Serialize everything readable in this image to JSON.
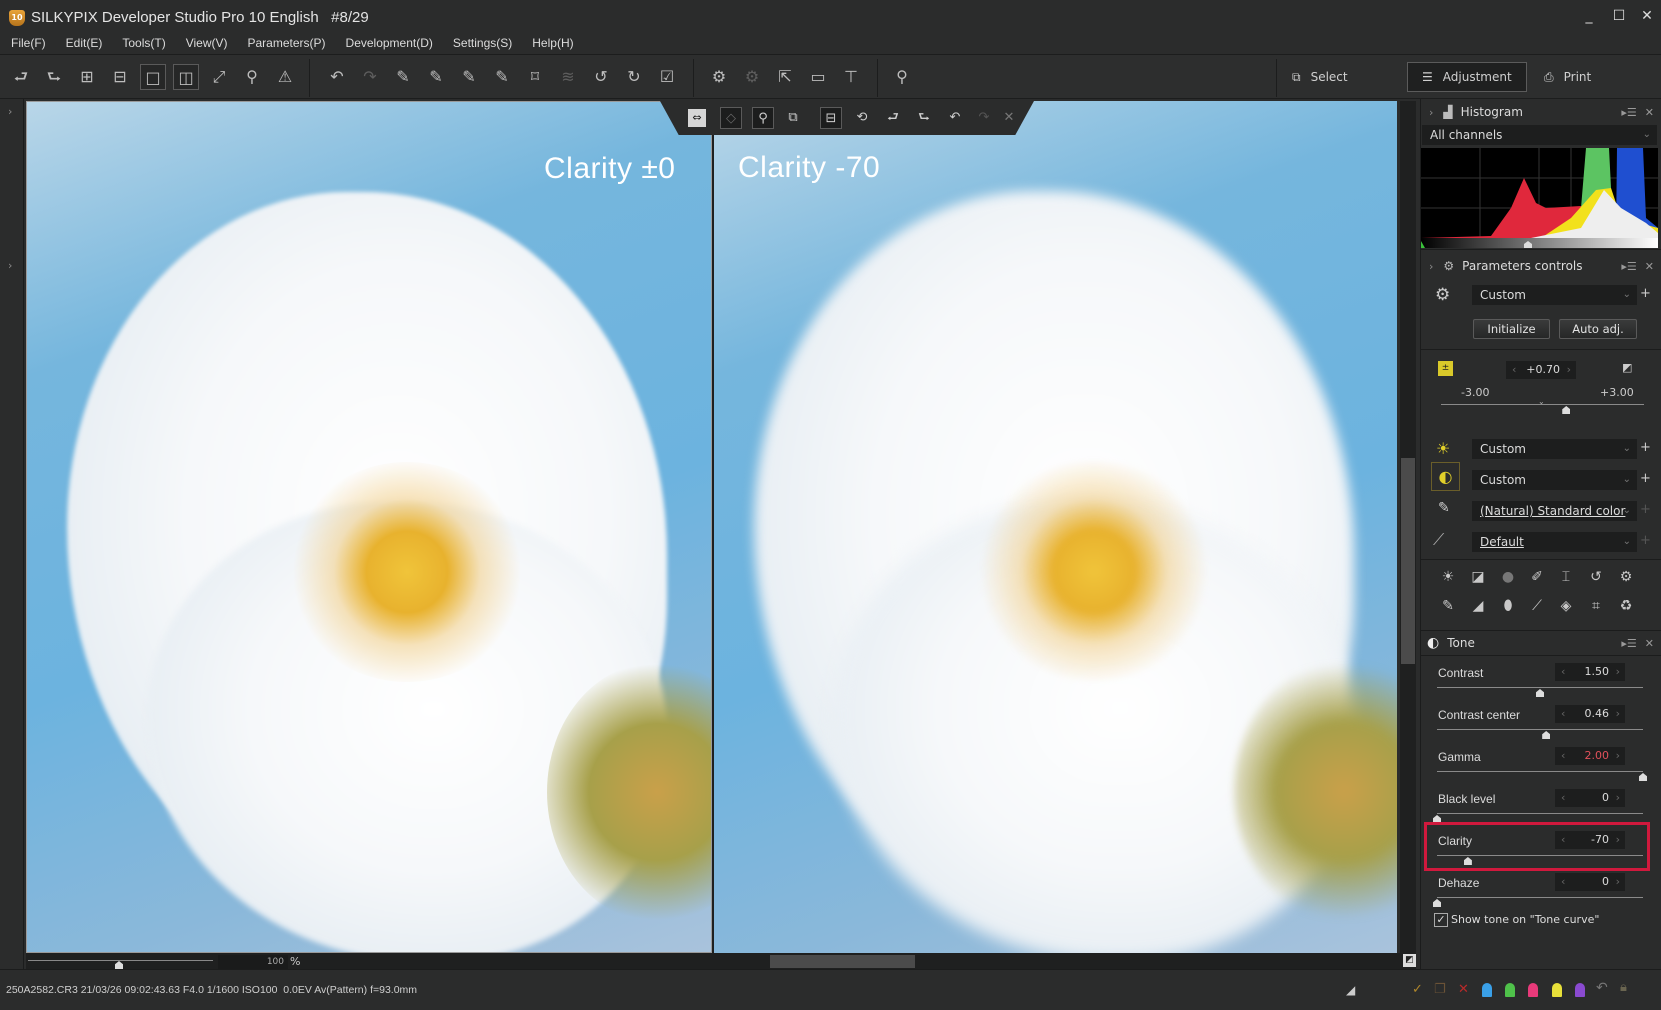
{
  "window": {
    "logo_text": "10",
    "title": "SILKYPIX Developer Studio Pro 10 English   #8/29",
    "controls": {
      "minimize": "_",
      "maximize": "☐",
      "close": "✕"
    }
  },
  "menu": [
    "File(F)",
    "Edit(E)",
    "Tools(T)",
    "View(V)",
    "Parameters(P)",
    "Development(D)",
    "Settings(S)",
    "Help(H)"
  ],
  "toolbar": {
    "icons": [
      "prev-photo-icon",
      "next-photo-icon",
      "thumbnail-grid-icon",
      "thumbnail-preview-icon",
      "single-view-icon",
      "compare-view-icon",
      "fullscreen-icon",
      "zoom-icon",
      "warning-icon",
      "undo-icon",
      "redo-icon",
      "paste-exposure-icon",
      "paste-tone-icon",
      "paste-contrast-icon",
      "paste-params-icon",
      "transform-icon",
      "layers-icon",
      "rotate-left-icon",
      "rotate-right-icon",
      "mark-icon",
      "save-params-icon",
      "apply-params-icon",
      "export-icon",
      "preview-screen-icon",
      "hammer-icon",
      "search-photo-icon"
    ],
    "modes": [
      {
        "label": "Select",
        "icon": "select-mode-icon",
        "active": false
      },
      {
        "label": "Adjustment",
        "icon": "adjustment-mode-icon",
        "active": true
      },
      {
        "label": "Print",
        "icon": "printer-icon",
        "active": false
      }
    ]
  },
  "viewer": {
    "left_label": "Clarity ±0",
    "right_label": "Clarity -70",
    "zoom_value": "100",
    "zoom_unit": "%",
    "compare_bar_icons": [
      "swap-left-icon",
      "swap-right-icon",
      "loupe-icon",
      "overlay-icon",
      "link-views-icon",
      "sync-icon",
      "prev-photo-icon",
      "next-photo-icon",
      "undo-icon",
      "redo-icon",
      "close-icon"
    ]
  },
  "status": {
    "text": "250A2582.CR3 21/03/26 09:02:43.63 F4.0 1/1600 ISO100  0.0EV Av(Pattern) f=93.0mm",
    "tag_colors": [
      "#3aa0e8",
      "#4fc14a",
      "#e83a7a",
      "#e8e03a",
      "#8a4ad0"
    ]
  },
  "panel": {
    "histogram": {
      "title": "Histogram",
      "channel": "All channels"
    },
    "params": {
      "title": "Parameters controls",
      "preset": "Custom",
      "initialize": "Initialize",
      "auto_adj": "Auto adj.",
      "exposure": {
        "value": "+0.70",
        "min": "-3.00",
        "max": "+3.00",
        "fraction": 0.617
      },
      "white_balance": "Custom",
      "tone": "Custom",
      "color": "(Natural) Standard color",
      "sharpness": "Default"
    },
    "tone": {
      "title": "Tone",
      "rows": [
        {
          "label": "Contrast",
          "value": "1.50",
          "fraction": 0.5,
          "red": false
        },
        {
          "label": "Contrast center",
          "value": "0.46",
          "fraction": 0.53,
          "red": false
        },
        {
          "label": "Gamma",
          "value": "2.00",
          "fraction": 1.0,
          "red": true
        },
        {
          "label": "Black level",
          "value": "0",
          "fraction": 0.0,
          "red": false
        },
        {
          "label": "Clarity",
          "value": "-70",
          "fraction": 0.15,
          "red": false
        },
        {
          "label": "Dehaze",
          "value": "0",
          "fraction": 0.0,
          "red": false
        }
      ],
      "show_tone_checkbox": {
        "label": "Show tone on \"Tone curve\"",
        "checked": true
      }
    }
  }
}
